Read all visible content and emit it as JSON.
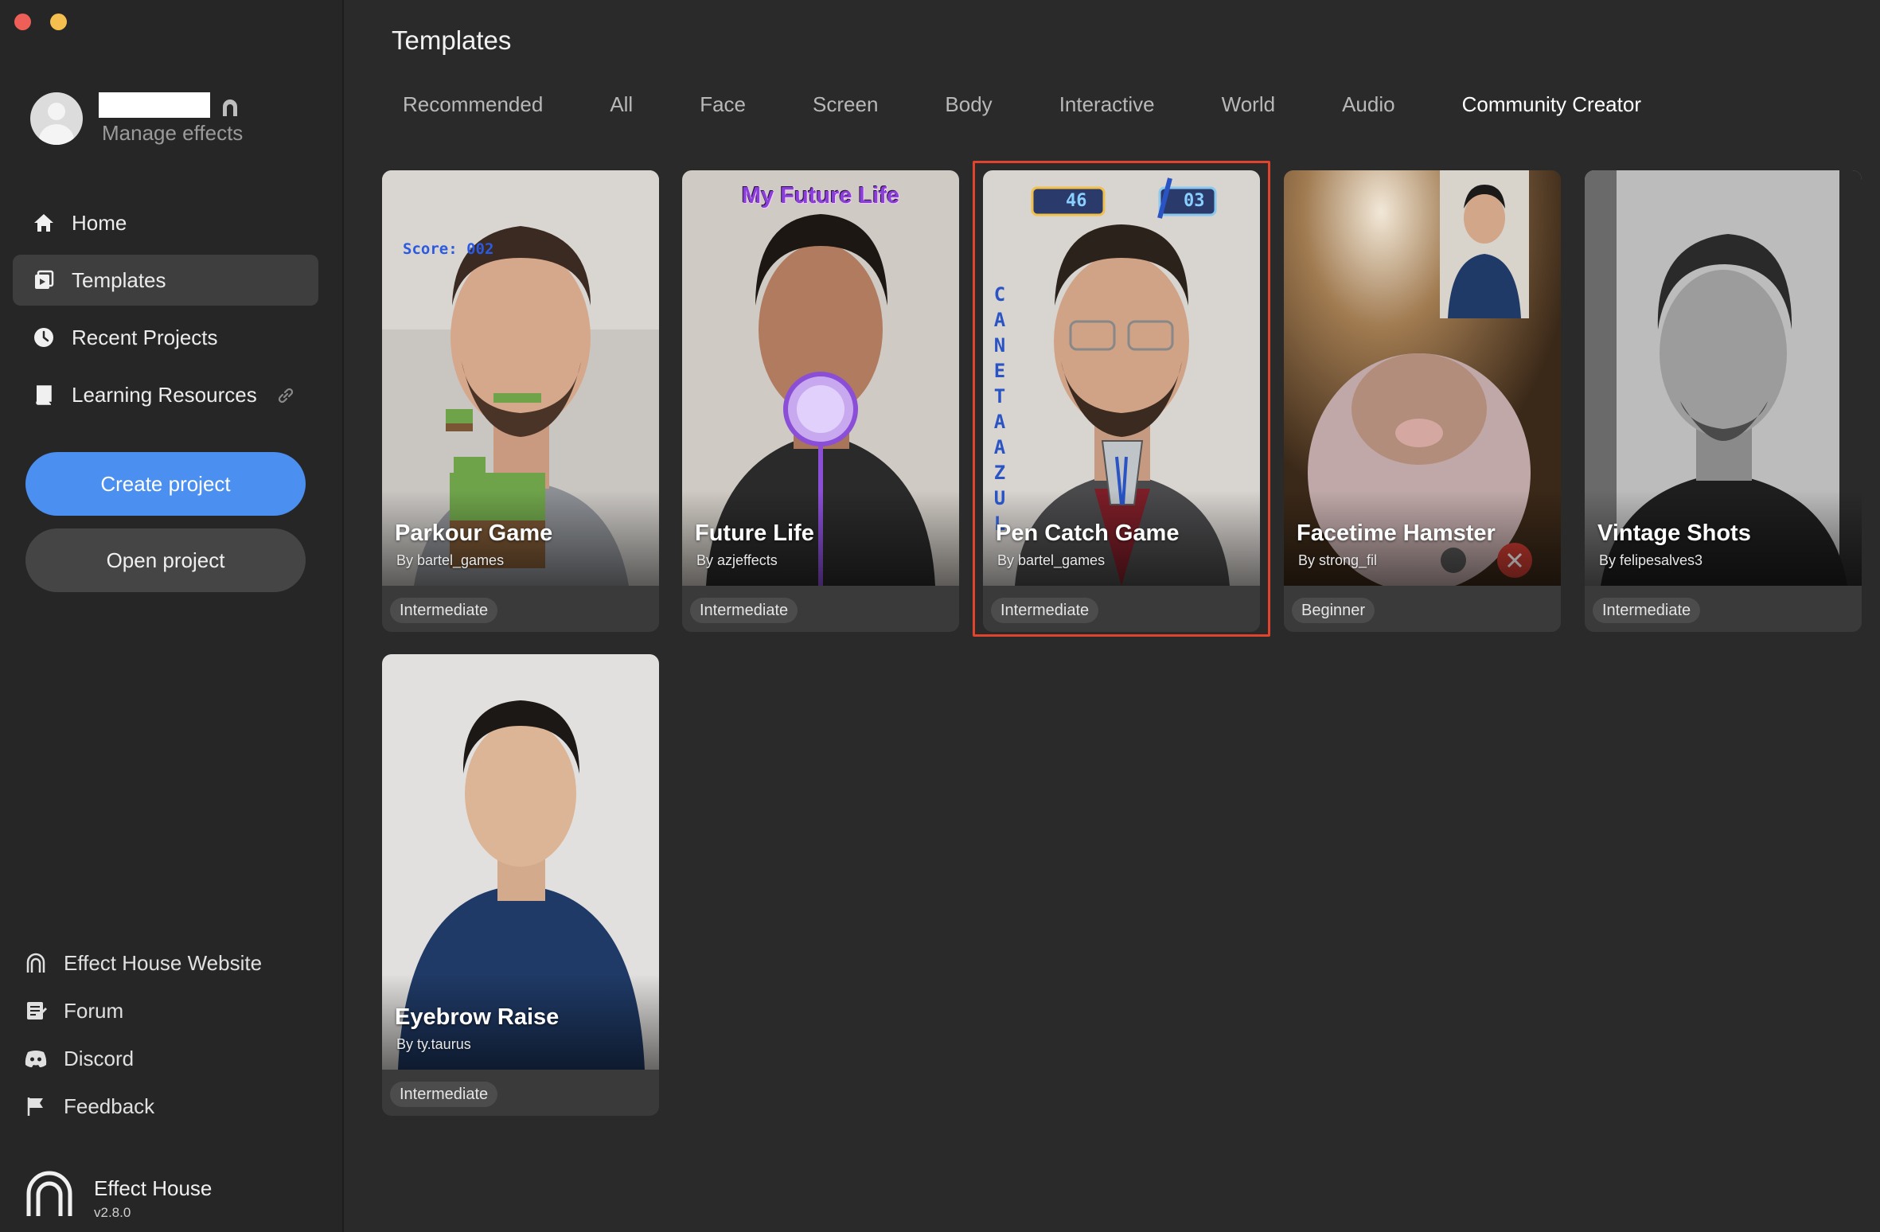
{
  "window": {
    "controls": [
      "close",
      "minimize"
    ]
  },
  "sidebar": {
    "profile": {
      "manage_label": "Manage effects"
    },
    "nav": [
      {
        "label": "Home",
        "icon": "home-icon",
        "active": false
      },
      {
        "label": "Templates",
        "icon": "templates-icon",
        "active": true
      },
      {
        "label": "Recent Projects",
        "icon": "clock-icon",
        "active": false
      },
      {
        "label": "Learning Resources",
        "icon": "book-icon",
        "active": false,
        "external": true
      }
    ],
    "create_label": "Create project",
    "open_label": "Open project",
    "bottom_links": [
      {
        "label": "Effect House Website",
        "icon": "effect-house-icon"
      },
      {
        "label": "Forum",
        "icon": "forum-icon"
      },
      {
        "label": "Discord",
        "icon": "discord-icon"
      },
      {
        "label": "Feedback",
        "icon": "flag-icon"
      }
    ],
    "brand": {
      "name": "Effect House",
      "version": "v2.8.0"
    }
  },
  "main": {
    "title": "Templates",
    "tabs": [
      {
        "label": "Recommended",
        "active": false
      },
      {
        "label": "All",
        "active": false
      },
      {
        "label": "Face",
        "active": false
      },
      {
        "label": "Screen",
        "active": false
      },
      {
        "label": "Body",
        "active": false
      },
      {
        "label": "Interactive",
        "active": false
      },
      {
        "label": "World",
        "active": false
      },
      {
        "label": "Audio",
        "active": false
      },
      {
        "label": "Community Creator",
        "active": true
      }
    ],
    "cards": [
      {
        "title": "Parkour Game",
        "author": "By bartel_games",
        "level": "Intermediate",
        "overlay": "Score: 002"
      },
      {
        "title": "Future Life",
        "author": "By azjeffects",
        "level": "Intermediate",
        "overlay": "My Future Life"
      },
      {
        "title": "Pen Catch Game",
        "author": "By bartel_games",
        "level": "Intermediate",
        "overlay_timer": "46",
        "overlay_count": "03",
        "vertical_text": "CANETAAZUL",
        "selected": true
      },
      {
        "title": "Facetime Hamster",
        "author": "By strong_fil",
        "level": "Beginner"
      },
      {
        "title": "Vintage Shots",
        "author": "By felipesalves3",
        "level": "Intermediate"
      },
      {
        "title": "Eyebrow Raise",
        "author": "By ty.taurus",
        "level": "Intermediate"
      }
    ]
  },
  "colors": {
    "accent": "#4b8ff0",
    "selection": "#e0442c",
    "background": "#2a2a2a",
    "sidebar": "#262626"
  }
}
